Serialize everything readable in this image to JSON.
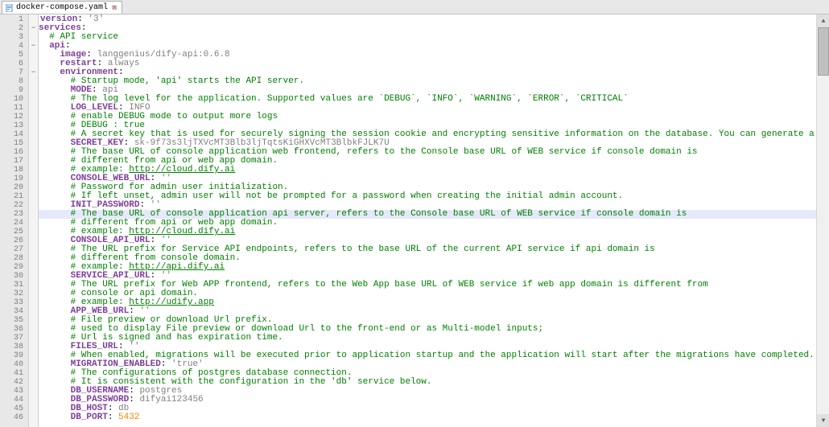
{
  "tab": {
    "filename": "docker-compose.yaml",
    "close_glyph": "⊠"
  },
  "scrollbar": {
    "up": "▲",
    "down": "▼"
  },
  "lines": [
    {
      "n": 1,
      "fold": "",
      "style": "",
      "html": "<span class='key'>version</span>: <span class='val'>'3'</span>"
    },
    {
      "n": 2,
      "fold": "−",
      "style": "red-bar",
      "html": "<span class='key'>services</span>:"
    },
    {
      "n": 3,
      "fold": "",
      "style": "red-bar",
      "html": "  <span class='cmt'># API service</span>"
    },
    {
      "n": 4,
      "fold": "−",
      "style": "red-bar",
      "html": "  <span class='key'>api</span>:"
    },
    {
      "n": 5,
      "fold": "",
      "style": "red-bar",
      "html": "    <span class='key'>image</span>: <span class='val'>langgenius/dify-api:0.6.8</span>"
    },
    {
      "n": 6,
      "fold": "",
      "style": "red-bar",
      "html": "    <span class='key'>restart</span>: <span class='val'>always</span>"
    },
    {
      "n": 7,
      "fold": "−",
      "style": "red-bar",
      "html": "    <span class='key'>environment</span>:"
    },
    {
      "n": 8,
      "fold": "",
      "style": "red-bar",
      "html": "      <span class='cmt'># Startup mode, 'api' starts the API server.</span>"
    },
    {
      "n": 9,
      "fold": "",
      "style": "red-bar",
      "html": "      <span class='key'>MODE</span>: <span class='val'>api</span>"
    },
    {
      "n": 10,
      "fold": "",
      "style": "red-bar",
      "html": "      <span class='cmt'># The log level for the application. Supported values are `DEBUG`, `INFO`, `WARNING`, `ERROR`, `CRITICAL`</span>"
    },
    {
      "n": 11,
      "fold": "",
      "style": "red-bar",
      "html": "      <span class='key'>LOG_LEVEL</span>: <span class='val'>INFO</span>"
    },
    {
      "n": 12,
      "fold": "",
      "style": "red-bar",
      "html": "      <span class='cmt'># enable DEBUG mode to output more logs</span>"
    },
    {
      "n": 13,
      "fold": "",
      "style": "red-bar",
      "html": "      <span class='cmt'># DEBUG : true</span>"
    },
    {
      "n": 14,
      "fold": "",
      "style": "red-bar",
      "html": "      <span class='cmt'># A secret key that is used for securely signing the session cookie and encrypting sensitive information on the database. You can generate a strong key using `openssl ra</span>"
    },
    {
      "n": 15,
      "fold": "",
      "style": "red-bar",
      "html": "      <span class='key'>SECRET_KEY</span>: <span class='val'>sk-9f73s3ljTXVcMT3Blb3ljTqtsKiGHXVcMT3BlbkFJLK7U</span>"
    },
    {
      "n": 16,
      "fold": "",
      "style": "red-bar",
      "html": "      <span class='cmt'># The base URL of console application web frontend, refers to the Console base URL of WEB service if console domain is</span>"
    },
    {
      "n": 17,
      "fold": "",
      "style": "red-bar",
      "html": "      <span class='cmt'># different from api or web app domain.</span>"
    },
    {
      "n": 18,
      "fold": "",
      "style": "red-bar",
      "html": "      <span class='cmt'># example: </span><span class='url'>http://cloud.dify.ai</span>"
    },
    {
      "n": 19,
      "fold": "",
      "style": "red-bar",
      "html": "      <span class='key'>CONSOLE_WEB_URL</span>: <span class='val'>''</span>"
    },
    {
      "n": 20,
      "fold": "",
      "style": "red-bar",
      "html": "      <span class='cmt'># Password for admin user initialization.</span>"
    },
    {
      "n": 21,
      "fold": "",
      "style": "red-bar",
      "html": "      <span class='cmt'># If left unset, admin user will not be prompted for a password when creating the initial admin account.</span>"
    },
    {
      "n": 22,
      "fold": "",
      "style": "red-bar",
      "html": "      <span class='key'>INIT_PASSWORD</span>: <span class='val'>''</span>"
    },
    {
      "n": 23,
      "fold": "",
      "style": "red-bar hl",
      "html": "      <span class='cmt'># The base URL of console application api server, refers to the Console base URL of WEB service if console domain is</span>"
    },
    {
      "n": 24,
      "fold": "",
      "style": "red-bar",
      "html": "      <span class='cmt'># different from api or web app domain.</span>"
    },
    {
      "n": 25,
      "fold": "",
      "style": "red-bar",
      "html": "      <span class='cmt'># example: </span><span class='url'>http://cloud.dify.ai</span>"
    },
    {
      "n": 26,
      "fold": "",
      "style": "red-bar",
      "html": "      <span class='key'>CONSOLE_API_URL</span>: <span class='val'>''</span>"
    },
    {
      "n": 27,
      "fold": "",
      "style": "red-bar",
      "html": "      <span class='cmt'># The URL prefix for Service API endpoints, refers to the base URL of the current API service if api domain is</span>"
    },
    {
      "n": 28,
      "fold": "",
      "style": "red-bar",
      "html": "      <span class='cmt'># different from console domain.</span>"
    },
    {
      "n": 29,
      "fold": "",
      "style": "red-bar",
      "html": "      <span class='cmt'># example: </span><span class='url'>http://api.dify.ai</span>"
    },
    {
      "n": 30,
      "fold": "",
      "style": "red-bar",
      "html": "      <span class='key'>SERVICE_API_URL</span>: <span class='val'>''</span>"
    },
    {
      "n": 31,
      "fold": "",
      "style": "red-bar",
      "html": "      <span class='cmt'># The URL prefix for Web APP frontend, refers to the Web App base URL of WEB service if web app domain is different from</span>"
    },
    {
      "n": 32,
      "fold": "",
      "style": "red-bar",
      "html": "      <span class='cmt'># console or api domain.</span>"
    },
    {
      "n": 33,
      "fold": "",
      "style": "red-bar",
      "html": "      <span class='cmt'># example: </span><span class='url'>http://udify.app</span>"
    },
    {
      "n": 34,
      "fold": "",
      "style": "red-bar",
      "html": "      <span class='key'>APP_WEB_URL</span>: <span class='val'>''</span>"
    },
    {
      "n": 35,
      "fold": "",
      "style": "red-bar",
      "html": "      <span class='cmt'># File preview or download Url prefix.</span>"
    },
    {
      "n": 36,
      "fold": "",
      "style": "red-bar",
      "html": "      <span class='cmt'># used to display File preview or download Url to the front-end or as Multi-model inputs;</span>"
    },
    {
      "n": 37,
      "fold": "",
      "style": "red-bar",
      "html": "      <span class='cmt'># Url is signed and has expiration time.</span>"
    },
    {
      "n": 38,
      "fold": "",
      "style": "red-bar",
      "html": "      <span class='key'>FILES_URL</span>: <span class='val'>''</span>"
    },
    {
      "n": 39,
      "fold": "",
      "style": "red-bar",
      "html": "      <span class='cmt'># When enabled, migrations will be executed prior to application startup and the application will start after the migrations have completed.</span>"
    },
    {
      "n": 40,
      "fold": "",
      "style": "red-bar",
      "html": "      <span class='key'>MIGRATION_ENABLED</span>: <span class='val'>'true'</span>"
    },
    {
      "n": 41,
      "fold": "",
      "style": "red-bar",
      "html": "      <span class='cmt'># The configurations of postgres database connection.</span>"
    },
    {
      "n": 42,
      "fold": "",
      "style": "red-bar",
      "html": "      <span class='cmt'># It is consistent with the configuration in the 'db' service below.</span>"
    },
    {
      "n": 43,
      "fold": "",
      "style": "red-bar",
      "html": "      <span class='key'>DB_USERNAME</span>: <span class='val'>postgres</span>"
    },
    {
      "n": 44,
      "fold": "",
      "style": "red-bar",
      "html": "      <span class='key'>DB_PASSWORD</span>: <span class='val'>difyai123456</span>"
    },
    {
      "n": 45,
      "fold": "",
      "style": "red-bar",
      "html": "      <span class='key'>DB_HOST</span>: <span class='val'>db</span>"
    },
    {
      "n": 46,
      "fold": "",
      "style": "red-bar",
      "html": "      <span class='key'>DB_PORT</span>: <span class='num'>5432</span>"
    }
  ]
}
